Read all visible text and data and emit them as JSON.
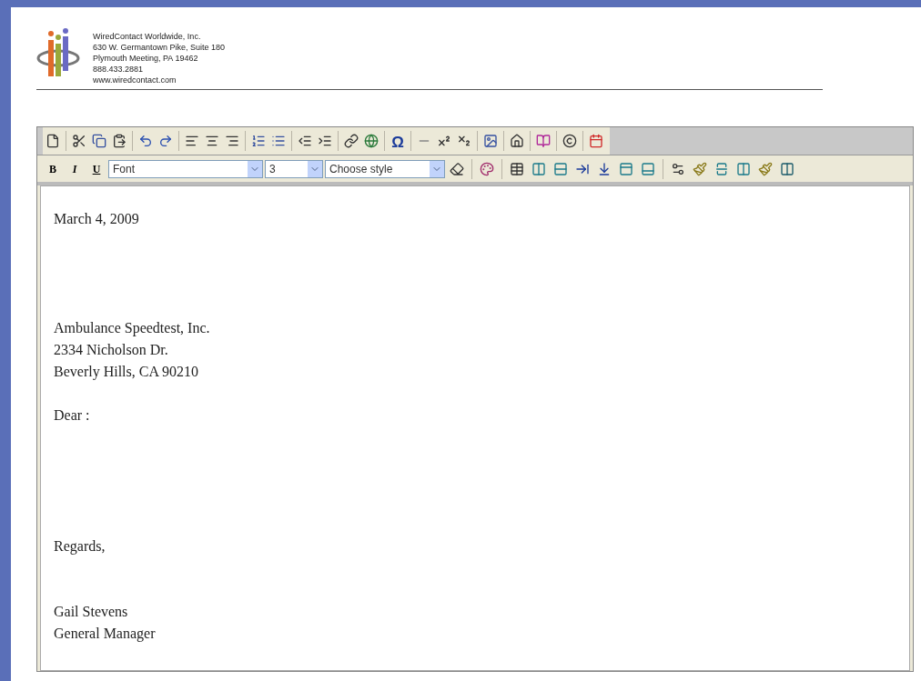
{
  "letterhead": {
    "lines": [
      "WiredContact Worldwide, Inc.",
      "630 W. Germantown Pike, Suite 180",
      "Plymouth Meeting, PA 19462",
      "888.433.2881",
      "www.wiredcontact.com"
    ]
  },
  "toolbar": {
    "special_char": "Ω",
    "bold": "B",
    "italic": "I",
    "underline": "U",
    "font_select": {
      "value": "Font"
    },
    "size_select": {
      "value": "3"
    },
    "style_select": {
      "value": "Choose style"
    }
  },
  "document": {
    "paragraphs": [
      {
        "lines": [
          "March 4, 2009"
        ]
      },
      {
        "lines": [
          "Ambulance Speedtest, Inc.",
          "2334 Nicholson Dr.",
          "Beverly Hills, CA 90210"
        ]
      },
      {
        "lines": [
          "Dear :"
        ]
      },
      {
        "lines": [
          "Regards,"
        ]
      },
      {
        "lines": [
          "Gail Stevens",
          "General Manager"
        ]
      }
    ]
  }
}
